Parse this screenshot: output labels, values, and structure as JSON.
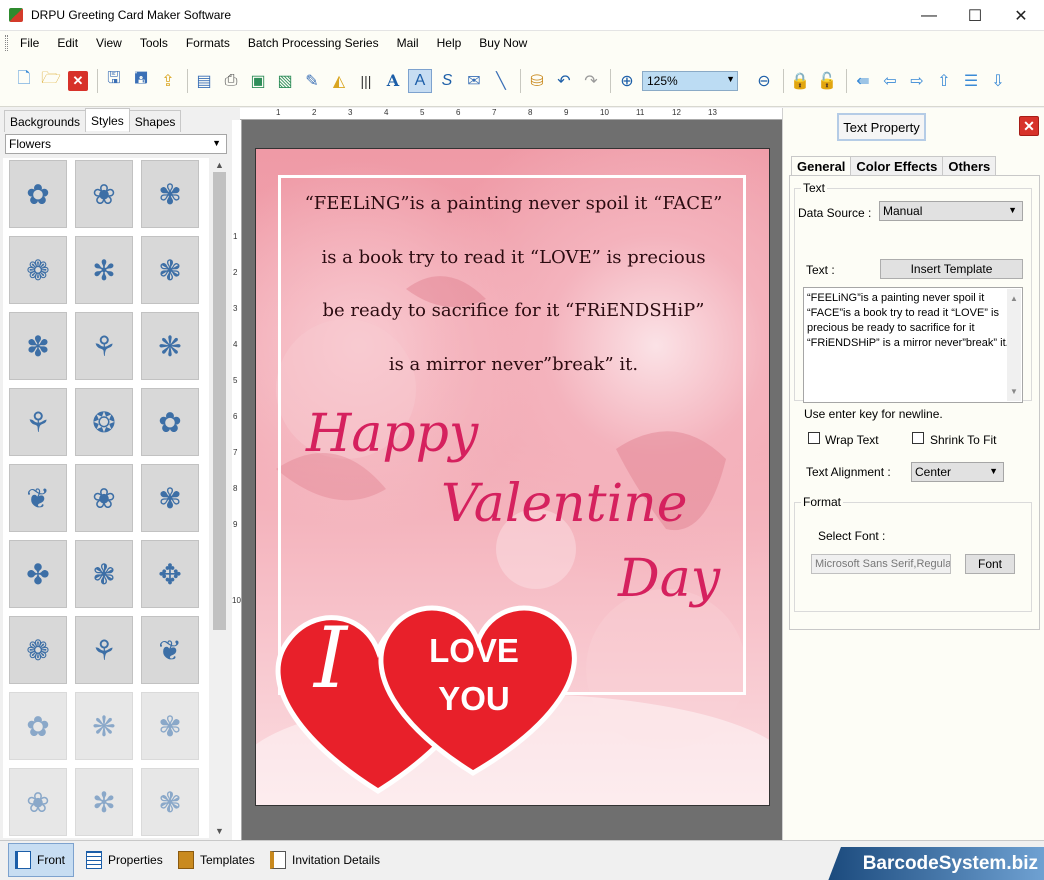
{
  "window": {
    "title": "DRPU Greeting Card Maker Software",
    "minimize": "—",
    "maximize": "☐",
    "close": "✕"
  },
  "menu": [
    "File",
    "Edit",
    "View",
    "Tools",
    "Formats",
    "Batch Processing Series",
    "Mail",
    "Help",
    "Buy Now"
  ],
  "toolbar": {
    "zoom_value": "125%",
    "icons": [
      "new-icon",
      "open-icon",
      "close-file-icon",
      "save-icon",
      "save-as-icon",
      "export-icon",
      "print-preview-icon",
      "print-icon",
      "image-icon",
      "pen-icon",
      "picture-icon",
      "barcode-icon",
      "text-icon",
      "text-select-icon",
      "signature-icon",
      "mail-icon",
      "line-icon",
      "database-icon",
      "undo-icon",
      "redo-icon",
      "zoom-in-icon",
      "zoom-out-icon",
      "lock-icon",
      "unlock-icon",
      "arrow-left-icon",
      "arrow-right-icon",
      "arrow-up-icon",
      "align-icon",
      "arrow-down-icon"
    ]
  },
  "left_panel": {
    "tabs": [
      "Backgrounds",
      "Styles",
      "Shapes"
    ],
    "active_tab": "Styles",
    "category": "Flowers",
    "thumb_color": "#3d6fa6"
  },
  "card": {
    "verse": [
      "“FEELiNG”is a painting never spoil it “FACE”",
      "is a book try to read it “LOVE” is precious",
      "be ready to sacrifice for it “FRiENDSHiP”",
      "is a mirror never”break” it."
    ],
    "happy": "Happy",
    "valentine": "Valentine",
    "day": "Day",
    "big_i": "I",
    "love": "LOVE",
    "you": "YOU",
    "heart_color": "#e8202a",
    "script_color": "#d5215e"
  },
  "text_property": {
    "title": "Text Property",
    "close": "✕",
    "tabs": [
      "General",
      "Color Effects",
      "Others"
    ],
    "text_group": "Text",
    "data_source_label": "Data Source :",
    "data_source_value": "Manual",
    "text_label": "Text :",
    "insert_template": "Insert Template",
    "text_value": "“FEELiNG”is a painting never spoil it “FACE”is a book try to read it “LOVE” is precious be ready to sacrifice for it “FRiENDSHiP” is a mirror never”break” it.",
    "newline_hint": "Use enter key for newline.",
    "wrap_text": "Wrap Text",
    "shrink_to_fit": "Shrink To Fit",
    "alignment_label": "Text Alignment :",
    "alignment_value": "Center",
    "format_group": "Format",
    "select_font_label": "Select Font :",
    "font_value": "Microsoft Sans Serif,Regular",
    "font_button": "Font"
  },
  "bottom_tabs": [
    "Front",
    "Properties",
    "Templates",
    "Invitation Details"
  ],
  "brand": "BarcodeSystem.biz"
}
